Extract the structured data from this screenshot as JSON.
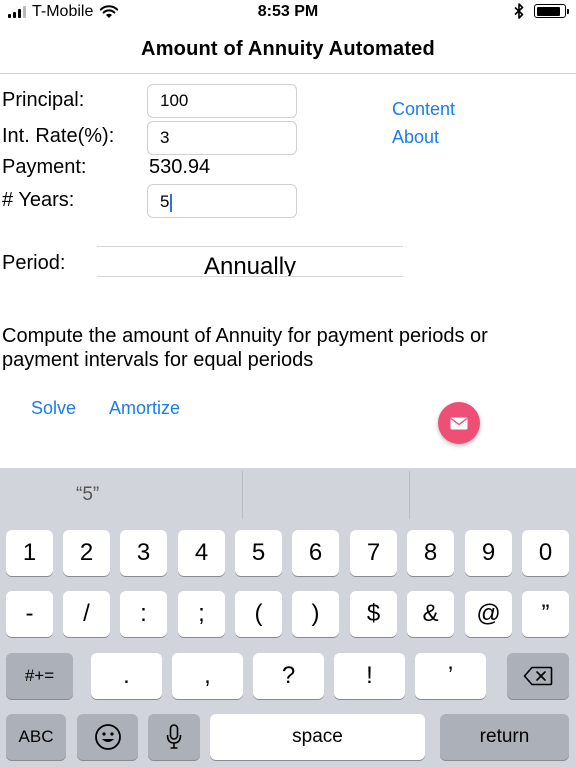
{
  "status_bar": {
    "carrier": "T-Mobile",
    "time": "8:53 PM",
    "icons": [
      "signal-icon",
      "wifi-icon",
      "bluetooth-icon",
      "battery-icon"
    ]
  },
  "nav": {
    "title": "Amount of Annuity Automated"
  },
  "form": {
    "principal_label": "Principal:",
    "principal_value": "100",
    "rate_label": "Int. Rate(%):",
    "rate_value": "3",
    "payment_label": "Payment:",
    "payment_value": "530.94",
    "years_label": "# Years:",
    "years_value": "5",
    "period_label": "Period:",
    "period_value": "Annually"
  },
  "links": {
    "content": "Content",
    "about": "About",
    "solve": "Solve",
    "amortize": "Amortize"
  },
  "description": "Compute the amount of Annuity for payment periods or payment intervals for equal periods",
  "colors": {
    "link": "#1a7cf0",
    "mail_button": "#ee4f75",
    "keyboard_bg": "#d1d4da",
    "key_dark": "#acb0b8"
  },
  "keyboard": {
    "prediction": "“5”",
    "row1": [
      "1",
      "2",
      "3",
      "4",
      "5",
      "6",
      "7",
      "8",
      "9",
      "0"
    ],
    "row2": [
      "-",
      "/",
      ":",
      ";",
      "(",
      ")",
      "$",
      "&",
      "@",
      "”"
    ],
    "row3": [
      "#+=",
      ".",
      ",",
      "?",
      "!",
      "’"
    ],
    "abc": "ABC",
    "space": "space",
    "return": "return"
  }
}
